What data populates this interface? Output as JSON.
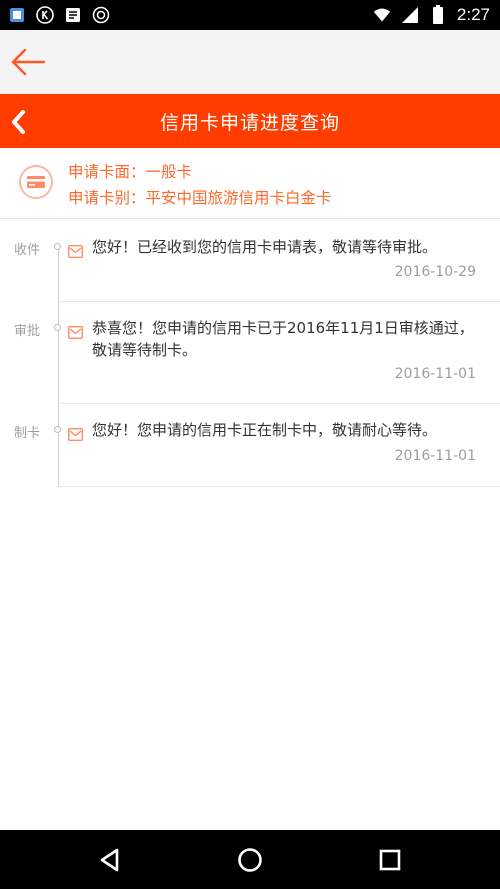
{
  "status_bar": {
    "time": "2:27",
    "left_icons": [
      "app-icon",
      "k-icon",
      "notes-icon",
      "circle-icon"
    ],
    "right_icons": [
      "wifi-icon",
      "signal-icon",
      "battery-icon"
    ]
  },
  "app_bar": {
    "back_icon": "back-arrow-icon"
  },
  "title_bar": {
    "title": "信用卡申请进度查询",
    "back_icon": "chevron-left-icon",
    "color": "#ff3d00"
  },
  "card_info": {
    "icon": "credit-card-icon",
    "card_face": "申请卡面：一般卡",
    "card_type": "申请卡别：平安中国旅游信用卡白金卡",
    "accent": "#ff6a2a"
  },
  "timeline": {
    "items": [
      {
        "stage": "收件",
        "message": "您好！已经收到您的信用卡申请表，敬请等待审批。",
        "date": "2016-10-29"
      },
      {
        "stage": "审批",
        "message": "恭喜您！您申请的信用卡已于2016年11月1日审核通过，敬请等待制卡。",
        "date": "2016-11-01"
      },
      {
        "stage": "制卡",
        "message": "您好！您申请的信用卡正在制卡中，敬请耐心等待。",
        "date": "2016-11-01"
      }
    ]
  },
  "nav_bar": {
    "icons": [
      "back-triangle-icon",
      "home-circle-icon",
      "recents-square-icon"
    ]
  }
}
